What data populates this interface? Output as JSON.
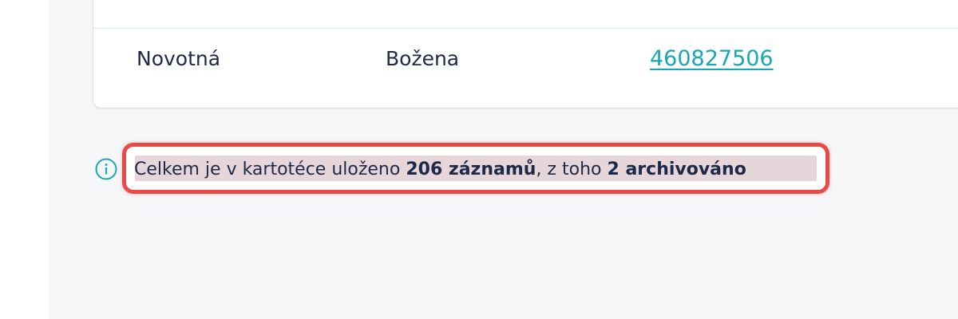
{
  "table": {
    "row": {
      "surname": "Novotná",
      "first_name": "Božena",
      "phone": "460827506"
    }
  },
  "summary": {
    "prefix": "Celkem je v kartotéce uloženo ",
    "records_count": "206 záznamů",
    "middle": ", z toho ",
    "archived_count": "2 archivováno"
  },
  "colors": {
    "link": "#1aa7b5",
    "highlight_border": "#e84b45",
    "text": "#1c2a4a",
    "info_icon": "#1aa7b5"
  },
  "icons": {
    "info": "info-circle-icon"
  }
}
